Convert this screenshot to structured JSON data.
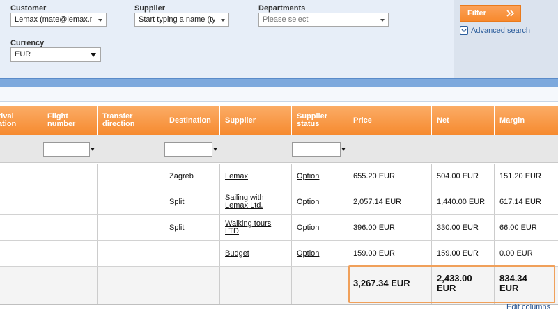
{
  "filters": {
    "customer": {
      "label": "Customer",
      "value": "Lemax (mate@lemax.n"
    },
    "supplier": {
      "label": "Supplier",
      "value": "Start typing a name (ty"
    },
    "departments": {
      "label": "Departments",
      "placeholder": "Please select"
    },
    "currency": {
      "label": "Currency",
      "value": "EUR"
    },
    "filter_button": "Filter",
    "advanced_search": "Advanced search"
  },
  "grid": {
    "columns": [
      "rival\nation",
      "Flight\nnumber",
      "Transfer\ndirection",
      "Destination",
      "Supplier",
      "Supplier\nstatus",
      "Price",
      "Net",
      "Margin"
    ],
    "rows": [
      {
        "destination": "Zagreb",
        "supplier": "Lemax",
        "status": "Option",
        "price": "655.20 EUR",
        "net": "504.00 EUR",
        "margin": "151.20 EUR"
      },
      {
        "destination": "Split",
        "supplier": "Sailing with\nLemax Ltd.",
        "status": "Option",
        "price": "2,057.14 EUR",
        "net": "1,440.00 EUR",
        "margin": "617.14 EUR"
      },
      {
        "destination": "Split",
        "supplier": "Walking tours\nLTD",
        "status": "Option",
        "price": "396.00 EUR",
        "net": "330.00 EUR",
        "margin": "66.00 EUR"
      },
      {
        "destination": "",
        "supplier": "Budget",
        "status": "Option",
        "price": "159.00 EUR",
        "net": "159.00 EUR",
        "margin": "0.00 EUR"
      }
    ],
    "totals": {
      "price": "3,267.34 EUR",
      "net": "2,433.00\nEUR",
      "margin": "834.34\nEUR"
    }
  },
  "footer": {
    "edit_columns": "Edit columns"
  },
  "colors": {
    "accent": "#f68a2f",
    "panel": "#e7eef8",
    "band": "#7da9dd",
    "link": "#2d5e9c",
    "highlight": "#f0a05a"
  }
}
